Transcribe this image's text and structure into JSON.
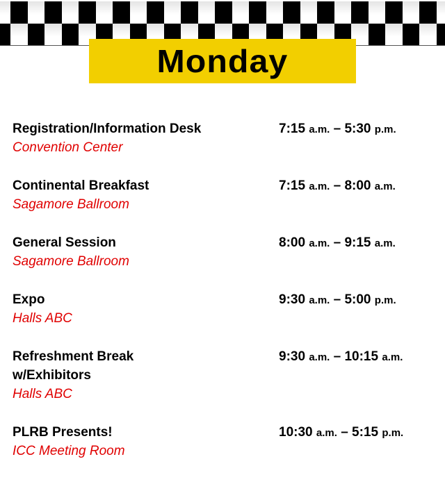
{
  "header": {
    "title": "Monday",
    "banner_color": "#f2cf00",
    "location_color": "#e00000"
  },
  "events": [
    {
      "name": [
        "Registration/Information  Desk"
      ],
      "location": "Convention Center",
      "start": "7:15",
      "start_suffix": "a.m.",
      "dash": "–",
      "end": "5:30",
      "end_suffix": "p.m."
    },
    {
      "name": [
        "Continental Breakfast"
      ],
      "location": "Sagamore Ballroom",
      "start": "7:15",
      "start_suffix": "a.m.",
      "dash": "–",
      "end": "8:00",
      "end_suffix": "a.m."
    },
    {
      "name": [
        "General Session"
      ],
      "location": "Sagamore Ballroom",
      "start": "8:00",
      "start_suffix": "a.m.",
      "dash": "–",
      "end": "9:15",
      "end_suffix": "a.m."
    },
    {
      "name": [
        "Expo"
      ],
      "location": "Halls ABC",
      "start": "9:30",
      "start_suffix": "a.m.",
      "dash": "–",
      "end": "5:00",
      "end_suffix": "p.m."
    },
    {
      "name": [
        "Refreshment Break",
        "w/Exhibitors"
      ],
      "location": "Halls ABC",
      "start": "9:30",
      "start_suffix": "a.m.",
      "dash": "–",
      "end": "10:15",
      "end_suffix": "a.m."
    },
    {
      "name": [
        "PLRB Presents!"
      ],
      "location": "ICC Meeting Room",
      "start": "10:30",
      "start_suffix": "a.m.",
      "dash": "–",
      "end": "5:15",
      "end_suffix": "p.m."
    }
  ]
}
